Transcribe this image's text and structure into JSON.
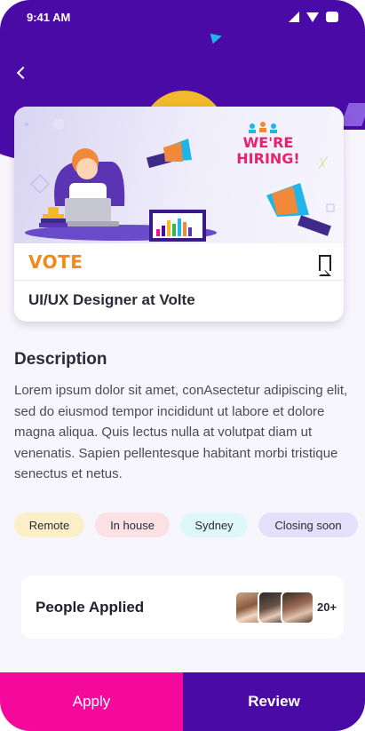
{
  "status_bar": {
    "time": "9:41 AM",
    "icons": [
      "signal-icon",
      "wifi-icon",
      "battery-icon"
    ]
  },
  "header": {
    "back_icon": "chevron-left-icon"
  },
  "job": {
    "banner_text": "WE'RE HIRING!",
    "company_logo_text": "VOTE",
    "bookmark_icon": "bookmark-icon",
    "title": "UI/UX Designer at Volte"
  },
  "description": {
    "heading": "Description",
    "body": "Lorem ipsum dolor sit amet, conAsectetur adipiscing elit, sed do eiusmod tempor incididunt ut labore et dolore magna aliqua. Quis lectus nulla at volutpat diam ut venenatis. Sapien pellentesque habitant morbi tristique senectus et netus."
  },
  "tags": [
    {
      "label": "Remote",
      "color": "#fbefc8"
    },
    {
      "label": "In house",
      "color": "#fbe0e4"
    },
    {
      "label": "Sydney",
      "color": "#def7fb"
    },
    {
      "label": "Closing soon",
      "color": "#e4e0fb"
    }
  ],
  "applied": {
    "label": "People Applied",
    "count": "20+"
  },
  "actions": {
    "apply_label": "Apply",
    "review_label": "Review"
  },
  "colors": {
    "primary": "#4a0aa6",
    "accent": "#f5099c",
    "yellow": "#f2b92a"
  }
}
